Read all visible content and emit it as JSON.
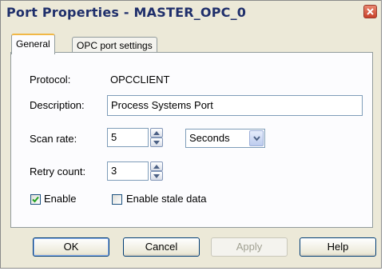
{
  "window": {
    "title": "Port Properties - MASTER_OPC_0"
  },
  "tabs": [
    {
      "label": "General",
      "active": true
    },
    {
      "label": "OPC port settings",
      "active": false
    }
  ],
  "general": {
    "protocol_label": "Protocol:",
    "protocol_value": "OPCCLIENT",
    "description_label": "Description:",
    "description_value": "Process Systems Port",
    "scan_rate_label": "Scan rate:",
    "scan_rate_value": "5",
    "scan_rate_unit": "Seconds",
    "retry_count_label": "Retry count:",
    "retry_count_value": "3",
    "enable_label": "Enable",
    "enable_checked": true,
    "enable_stale_label": "Enable stale data",
    "enable_stale_checked": false
  },
  "buttons": {
    "ok": "OK",
    "cancel": "Cancel",
    "apply": "Apply",
    "help": "Help"
  },
  "icons": {
    "close": "close-icon",
    "spin_up": "spin-up-icon",
    "spin_down": "spin-down-icon",
    "dropdown": "chevron-down-icon",
    "check": "check-icon"
  },
  "colors": {
    "title_text": "#1f2f6b",
    "close_button": "#c8402a",
    "tab_highlight": "#f1b847",
    "checkbox_check": "#21a121",
    "dialog_bg": "#ece9d8"
  }
}
